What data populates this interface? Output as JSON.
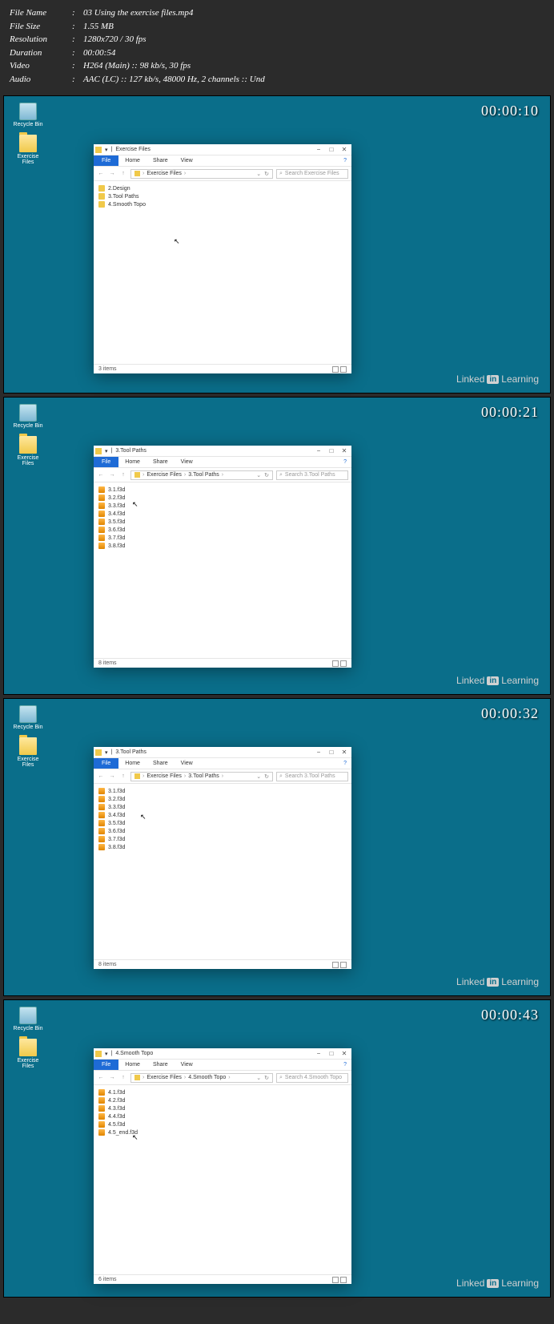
{
  "header": {
    "file_name_label": "File Name",
    "file_name": "03 Using the exercise files.mp4",
    "file_size_label": "File Size",
    "file_size": "1.55 MB",
    "resolution_label": "Resolution",
    "resolution": "1280x720 / 30 fps",
    "duration_label": "Duration",
    "duration": "00:00:54",
    "video_label": "Video",
    "video": "H264 (Main) :: 98 kb/s, 30 fps",
    "audio_label": "Audio",
    "audio": "AAC (LC) :: 127 kb/s, 48000 Hz, 2 channels :: Und"
  },
  "watermark": {
    "pre": "Linked",
    "in": "in",
    "post": "Learning"
  },
  "desktop": {
    "recycle": "Recycle Bin",
    "exfiles": "Exercise Files"
  },
  "ribbon": {
    "file": "File",
    "home": "Home",
    "share": "Share",
    "view": "View"
  },
  "win": {
    "min": "−",
    "max": "□",
    "close": "✕"
  },
  "frames": [
    {
      "timestamp": "00:00:10",
      "title": "Exercise Files",
      "crumbs": [
        "Exercise Files"
      ],
      "search_ph": "Search Exercise Files",
      "items": [
        "2.Design",
        "3.Tool Paths",
        "4.Smooth Topo"
      ],
      "icon_type": "folder",
      "status": "3 items",
      "body_h": 228
    },
    {
      "timestamp": "00:00:21",
      "title": "3.Tool Paths",
      "crumbs": [
        "Exercise Files",
        "3.Tool Paths"
      ],
      "search_ph": "Search 3.Tool Paths",
      "items": [
        "3.1.f3d",
        "3.2.f3d",
        "3.3.f3d",
        "3.4.f3d",
        "3.5.f3d",
        "3.6.f3d",
        "3.7.f3d",
        "3.8.f3d"
      ],
      "icon_type": "f3d",
      "status": "8 items",
      "body_h": 219
    },
    {
      "timestamp": "00:00:32",
      "title": "3.Tool Paths",
      "crumbs": [
        "Exercise Files",
        "3.Tool Paths"
      ],
      "search_ph": "Search 3.Tool Paths",
      "items": [
        "3.1.f3d",
        "3.2.f3d",
        "3.3.f3d",
        "3.4.f3d",
        "3.5.f3d",
        "3.6.f3d",
        "3.7.f3d",
        "3.8.f3d"
      ],
      "icon_type": "f3d",
      "status": "8 items",
      "body_h": 219
    },
    {
      "timestamp": "00:00:43",
      "title": "4.Smooth Topo",
      "crumbs": [
        "Exercise Files",
        "4.Smooth Topo"
      ],
      "search_ph": "Search 4.Smooth Topo",
      "items": [
        "4.1.f3d",
        "4.2.f3d",
        "4.3.f3d",
        "4.4.f3d",
        "4.5.f3d",
        "4.5_end.f3d"
      ],
      "icon_type": "f3d",
      "status": "6 items",
      "body_h": 236
    }
  ]
}
